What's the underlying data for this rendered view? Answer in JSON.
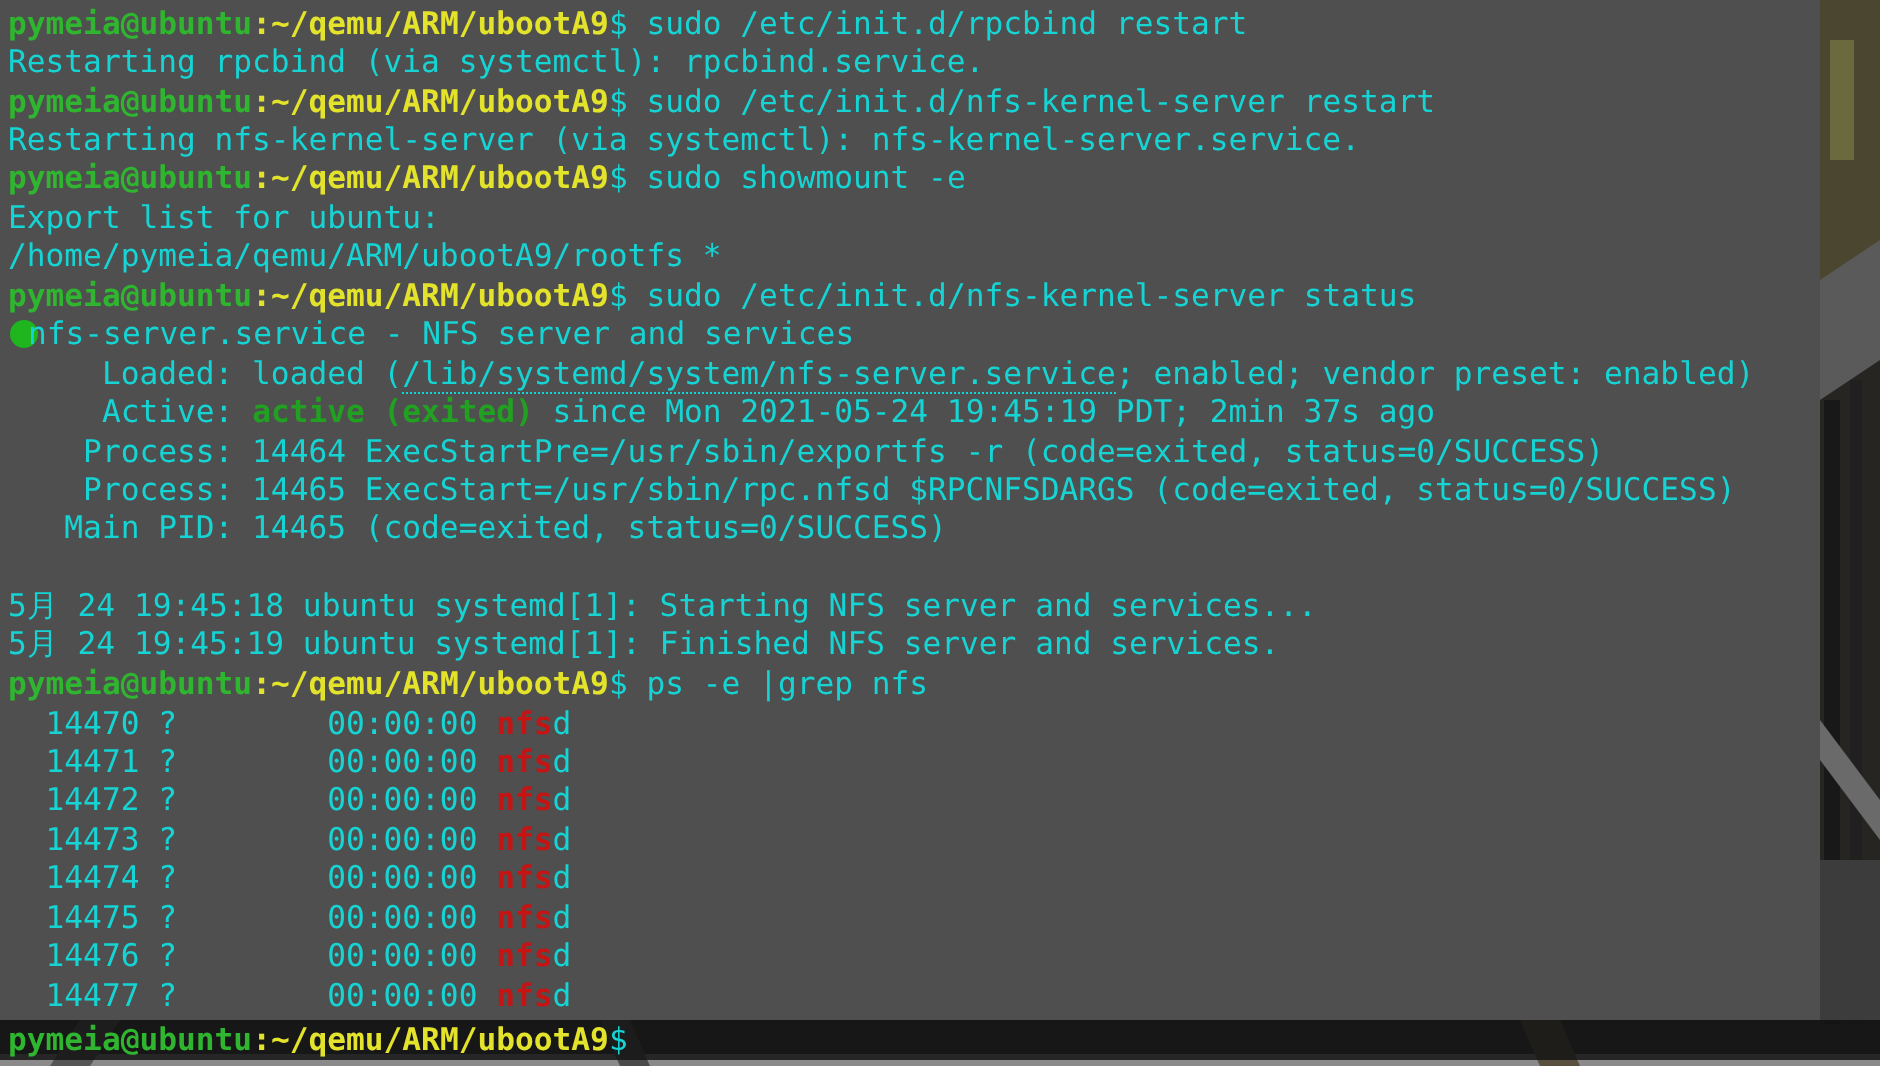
{
  "terminal": {
    "lines": [
      {
        "kind": "prompt",
        "segments": [
          {
            "kind": "user",
            "text": "pymeia@ubuntu"
          },
          {
            "kind": "path",
            "text": ":~/qemu/ARM/ubootA9"
          },
          {
            "kind": "plain",
            "text": "$ sudo /etc/init.d/rpcbind restart"
          }
        ]
      },
      {
        "kind": "output",
        "segments": [
          {
            "kind": "plain",
            "text": "Restarting rpcbind (via systemctl): rpcbind.service."
          }
        ]
      },
      {
        "kind": "prompt",
        "segments": [
          {
            "kind": "user",
            "text": "pymeia@ubuntu"
          },
          {
            "kind": "path",
            "text": ":~/qemu/ARM/ubootA9"
          },
          {
            "kind": "plain",
            "text": "$ sudo /etc/init.d/nfs-kernel-server restart"
          }
        ]
      },
      {
        "kind": "output",
        "segments": [
          {
            "kind": "plain",
            "text": "Restarting nfs-kernel-server (via systemctl): nfs-kernel-server.service."
          }
        ]
      },
      {
        "kind": "prompt",
        "segments": [
          {
            "kind": "user",
            "text": "pymeia@ubuntu"
          },
          {
            "kind": "path",
            "text": ":~/qemu/ARM/ubootA9"
          },
          {
            "kind": "plain",
            "text": "$ sudo showmount -e"
          }
        ]
      },
      {
        "kind": "output",
        "segments": [
          {
            "kind": "plain",
            "text": "Export list for ubuntu:"
          }
        ]
      },
      {
        "kind": "output",
        "segments": [
          {
            "kind": "plain",
            "text": "/home/pymeia/qemu/ARM/ubootA9/rootfs *"
          }
        ]
      },
      {
        "kind": "prompt",
        "segments": [
          {
            "kind": "user",
            "text": "pymeia@ubuntu"
          },
          {
            "kind": "path",
            "text": ":~/qemu/ARM/ubootA9"
          },
          {
            "kind": "plain",
            "text": "$ sudo /etc/init.d/nfs-kernel-server status"
          }
        ]
      },
      {
        "kind": "output",
        "segments": [
          {
            "kind": "dot"
          },
          {
            "kind": "plain",
            "text": "nfs-server.service - NFS server and services"
          }
        ]
      },
      {
        "kind": "output",
        "segments": [
          {
            "kind": "plain",
            "text": "     Loaded: loaded ("
          },
          {
            "kind": "link",
            "text": "/lib/systemd/system/nfs-server.service"
          },
          {
            "kind": "plain",
            "text": "; enabled; vendor preset: enabled)"
          }
        ]
      },
      {
        "kind": "output",
        "segments": [
          {
            "kind": "plain",
            "text": "     Active: "
          },
          {
            "kind": "active",
            "text": "active (exited)"
          },
          {
            "kind": "plain",
            "text": " since Mon 2021-05-24 19:45:19 PDT; 2min 37s ago"
          }
        ]
      },
      {
        "kind": "output",
        "segments": [
          {
            "kind": "plain",
            "text": "    Process: 14464 ExecStartPre=/usr/sbin/exportfs -r (code=exited, status=0/SUCCESS)"
          }
        ]
      },
      {
        "kind": "output",
        "segments": [
          {
            "kind": "plain",
            "text": "    Process: 14465 ExecStart=/usr/sbin/rpc.nfsd $RPCNFSDARGS (code=exited, status=0/SUCCESS)"
          }
        ]
      },
      {
        "kind": "output",
        "segments": [
          {
            "kind": "plain",
            "text": "   Main PID: 14465 (code=exited, status=0/SUCCESS)"
          }
        ]
      },
      {
        "kind": "blank"
      },
      {
        "kind": "output",
        "segments": [
          {
            "kind": "plain",
            "text": "5月 24 19:45:18 ubuntu systemd[1]: Starting NFS server and services..."
          }
        ]
      },
      {
        "kind": "output",
        "segments": [
          {
            "kind": "plain",
            "text": "5月 24 19:45:19 ubuntu systemd[1]: Finished NFS server and services."
          }
        ]
      },
      {
        "kind": "prompt",
        "segments": [
          {
            "kind": "user",
            "text": "pymeia@ubuntu"
          },
          {
            "kind": "path",
            "text": ":~/qemu/ARM/ubootA9"
          },
          {
            "kind": "plain",
            "text": "$ ps -e |grep nfs"
          }
        ]
      },
      {
        "kind": "output",
        "segments": [
          {
            "kind": "plain",
            "text": "  14470 ?        00:00:00 "
          },
          {
            "kind": "match",
            "text": "nfs"
          },
          {
            "kind": "plain",
            "text": "d"
          }
        ]
      },
      {
        "kind": "output",
        "segments": [
          {
            "kind": "plain",
            "text": "  14471 ?        00:00:00 "
          },
          {
            "kind": "match",
            "text": "nfs"
          },
          {
            "kind": "plain",
            "text": "d"
          }
        ]
      },
      {
        "kind": "output",
        "segments": [
          {
            "kind": "plain",
            "text": "  14472 ?        00:00:00 "
          },
          {
            "kind": "match",
            "text": "nfs"
          },
          {
            "kind": "plain",
            "text": "d"
          }
        ]
      },
      {
        "kind": "output",
        "segments": [
          {
            "kind": "plain",
            "text": "  14473 ?        00:00:00 "
          },
          {
            "kind": "match",
            "text": "nfs"
          },
          {
            "kind": "plain",
            "text": "d"
          }
        ]
      },
      {
        "kind": "output",
        "segments": [
          {
            "kind": "plain",
            "text": "  14474 ?        00:00:00 "
          },
          {
            "kind": "match",
            "text": "nfs"
          },
          {
            "kind": "plain",
            "text": "d"
          }
        ]
      },
      {
        "kind": "output",
        "segments": [
          {
            "kind": "plain",
            "text": "  14475 ?        00:00:00 "
          },
          {
            "kind": "match",
            "text": "nfs"
          },
          {
            "kind": "plain",
            "text": "d"
          }
        ]
      },
      {
        "kind": "output",
        "segments": [
          {
            "kind": "plain",
            "text": "  14476 ?        00:00:00 "
          },
          {
            "kind": "match",
            "text": "nfs"
          },
          {
            "kind": "plain",
            "text": "d"
          }
        ]
      },
      {
        "kind": "output",
        "segments": [
          {
            "kind": "plain",
            "text": "  14477 ?        00:00:00 "
          },
          {
            "kind": "match",
            "text": "nfs"
          },
          {
            "kind": "plain",
            "text": "d"
          }
        ]
      }
    ]
  },
  "bottom_prompt": {
    "segments": [
      {
        "kind": "user",
        "text": "pymeia@ubuntu"
      },
      {
        "kind": "path",
        "text": ":~/qemu/ARM/ubootA9"
      },
      {
        "kind": "plain",
        "text": "$"
      }
    ]
  }
}
